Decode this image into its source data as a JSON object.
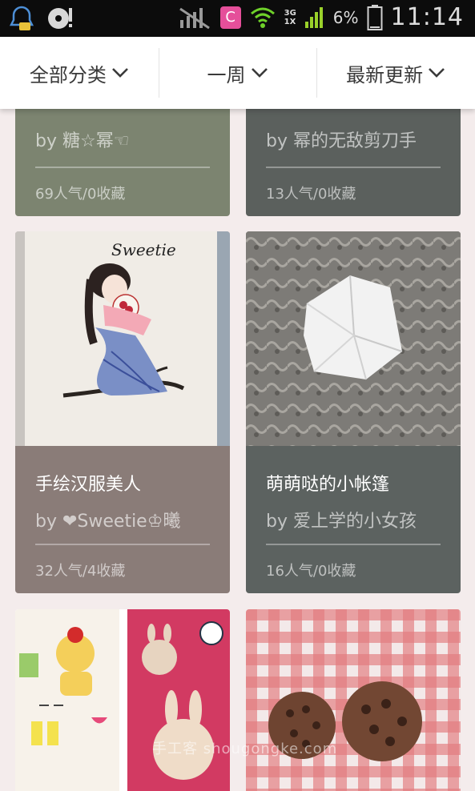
{
  "status_bar": {
    "time": "11:14",
    "battery_percent": "6%",
    "app_badge": "C",
    "network_top": "3G",
    "network_bottom": "1X"
  },
  "filters": [
    {
      "label": "全部分类"
    },
    {
      "label": "一周"
    },
    {
      "label": "最新更新"
    }
  ],
  "cards": [
    {
      "author": "by 糖☆幂☜",
      "stats": "69人气/0收藏",
      "color": "#7c8470"
    },
    {
      "author": "by 幂的无敌剪刀手",
      "stats": "13人气/0收藏",
      "color": "#5b605d"
    },
    {
      "title": "手绘汉服美人",
      "author": "by ❤Sweetie♔曦",
      "stats": "32人气/4收藏",
      "color": "#8a7c78"
    },
    {
      "title": "萌萌哒的小帐篷",
      "author": "by 爱上学的小女孩",
      "stats": "16人气/0收藏",
      "color": "#5c6260"
    }
  ],
  "watermark": "手工客 shougongke.com"
}
